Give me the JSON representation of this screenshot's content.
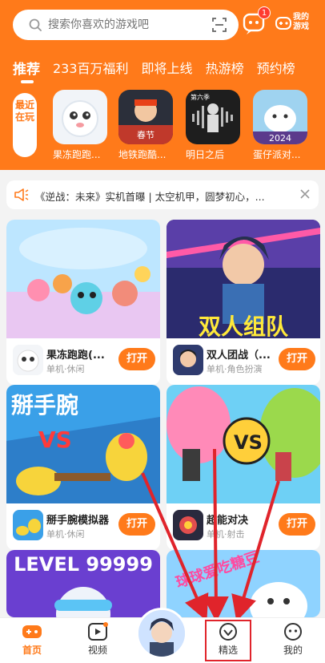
{
  "search": {
    "placeholder": "搜索你喜欢的游戏吧"
  },
  "header": {
    "message_badge": "1",
    "my_games_label": "我的游戏"
  },
  "tabs": [
    {
      "label": "推荐",
      "active": true
    },
    {
      "label": "233百万福利"
    },
    {
      "label": "即将上线"
    },
    {
      "label": "热游榜"
    },
    {
      "label": "预约榜"
    }
  ],
  "recent": {
    "label": "最近在玩",
    "games": [
      {
        "name": "果冻跑跑..."
      },
      {
        "name": "地铁跑酷..."
      },
      {
        "name": "明日之后"
      },
      {
        "name": "蛋仔派对..."
      }
    ]
  },
  "notice": {
    "text": "《逆战：未来》实机首曝 | 太空机甲，圆梦初心，..."
  },
  "cards": [
    {
      "title": "果冻跑跑(...",
      "meta": "单机·休闲",
      "button": "打开"
    },
    {
      "title": "双人团战（...",
      "meta": "单机·角色扮演",
      "button": "打开",
      "banner": "双人组队"
    },
    {
      "title": "掰手腕模拟器",
      "meta": "单机·休闲",
      "button": "打开",
      "banner": "掰手腕"
    },
    {
      "title": "超能对决",
      "meta": "单机·射击",
      "button": "打开"
    },
    {
      "banner": "LEVEL 99999"
    },
    {
      "banner": "球球爱吃糖豆"
    }
  ],
  "bottom_nav": [
    {
      "label": "首页",
      "active": true
    },
    {
      "label": "视频"
    },
    {
      "label": "精选"
    },
    {
      "label": "我的"
    }
  ],
  "colors": {
    "accent": "#ff7a1a",
    "annotation": "#e0242b"
  }
}
